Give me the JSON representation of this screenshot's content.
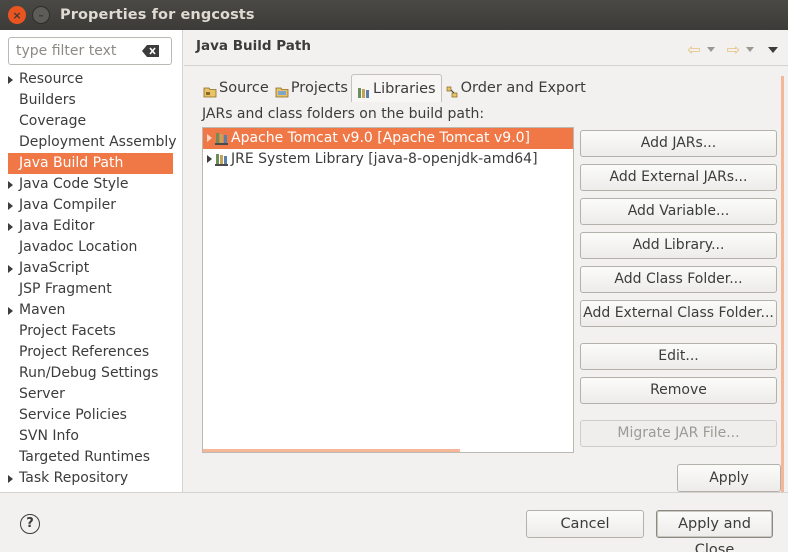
{
  "window": {
    "title": "Properties for engcosts",
    "close_glyph": "×",
    "min_glyph": "–"
  },
  "filter": {
    "placeholder": "type filter text"
  },
  "tree": {
    "items": [
      {
        "label": "Resource",
        "expandable": true,
        "selected": false
      },
      {
        "label": "Builders",
        "expandable": false,
        "selected": false
      },
      {
        "label": "Coverage",
        "expandable": false,
        "selected": false
      },
      {
        "label": "Deployment Assembly",
        "expandable": false,
        "selected": false
      },
      {
        "label": "Java Build Path",
        "expandable": false,
        "selected": true
      },
      {
        "label": "Java Code Style",
        "expandable": true,
        "selected": false
      },
      {
        "label": "Java Compiler",
        "expandable": true,
        "selected": false
      },
      {
        "label": "Java Editor",
        "expandable": true,
        "selected": false
      },
      {
        "label": "Javadoc Location",
        "expandable": false,
        "selected": false
      },
      {
        "label": "JavaScript",
        "expandable": true,
        "selected": false
      },
      {
        "label": "JSP Fragment",
        "expandable": false,
        "selected": false
      },
      {
        "label": "Maven",
        "expandable": true,
        "selected": false
      },
      {
        "label": "Project Facets",
        "expandable": false,
        "selected": false
      },
      {
        "label": "Project References",
        "expandable": false,
        "selected": false
      },
      {
        "label": "Run/Debug Settings",
        "expandable": false,
        "selected": false
      },
      {
        "label": "Server",
        "expandable": false,
        "selected": false
      },
      {
        "label": "Service Policies",
        "expandable": false,
        "selected": false
      },
      {
        "label": "SVN Info",
        "expandable": false,
        "selected": false
      },
      {
        "label": "Targeted Runtimes",
        "expandable": false,
        "selected": false
      },
      {
        "label": "Task Repository",
        "expandable": true,
        "selected": false
      }
    ]
  },
  "page": {
    "title": "Java Build Path",
    "back_glyph": "⇦",
    "forward_glyph": "⇨"
  },
  "tabs": [
    {
      "label": "Source",
      "icon": "source-folder-icon",
      "active": false
    },
    {
      "label": "Projects",
      "icon": "projects-folder-icon",
      "active": false
    },
    {
      "label": "Libraries",
      "icon": "libraries-icon",
      "active": true
    },
    {
      "label": "Order and Export",
      "icon": "order-export-icon",
      "active": false
    }
  ],
  "libraries": {
    "description": "JARs and class folders on the build path:",
    "entries": [
      {
        "label": "Apache Tomcat v9.0 [Apache Tomcat v9.0]",
        "selected": true
      },
      {
        "label": "JRE System Library [java-8-openjdk-amd64]",
        "selected": false
      }
    ]
  },
  "buttons": {
    "add_jars": "Add JARs...",
    "add_external_jars": "Add External JARs...",
    "add_variable": "Add Variable...",
    "add_library": "Add Library...",
    "add_class_folder": "Add Class Folder...",
    "add_external_class_folder": "Add External Class Folder...",
    "edit": "Edit...",
    "remove": "Remove",
    "migrate_jar": "Migrate JAR File...",
    "apply": "Apply"
  },
  "bottom": {
    "help_glyph": "?",
    "cancel": "Cancel",
    "apply_and_close": "Apply and Close"
  },
  "colors": {
    "selection": "#f07746",
    "titlebar": "#3c3b37",
    "close_button": "#e95420"
  }
}
